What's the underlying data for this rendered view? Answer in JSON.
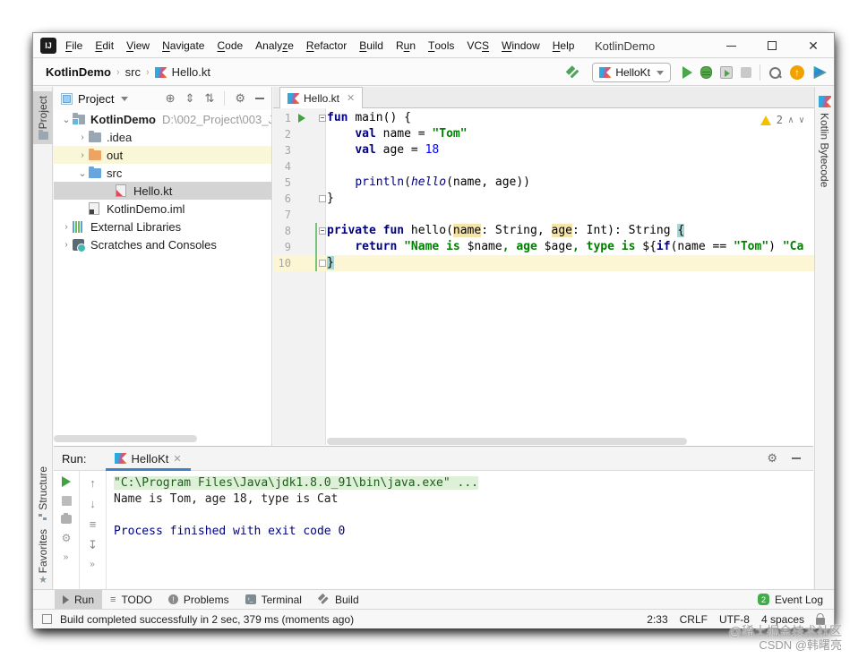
{
  "window": {
    "title": "KotlinDemo"
  },
  "menu": {
    "items": [
      {
        "label": "File",
        "m": 0
      },
      {
        "label": "Edit",
        "m": 0
      },
      {
        "label": "View",
        "m": 0
      },
      {
        "label": "Navigate",
        "m": 0
      },
      {
        "label": "Code",
        "m": 0
      },
      {
        "label": "Analyze",
        "m": 5
      },
      {
        "label": "Refactor",
        "m": 0
      },
      {
        "label": "Build",
        "m": 0
      },
      {
        "label": "Run",
        "m": 1
      },
      {
        "label": "Tools",
        "m": 0
      },
      {
        "label": "VCS",
        "m": 2
      },
      {
        "label": "Window",
        "m": 0
      },
      {
        "label": "Help",
        "m": 0
      }
    ]
  },
  "toolbar": {
    "breadcrumb": [
      "KotlinDemo",
      "src",
      "Hello.kt"
    ],
    "run_config": "HelloKt"
  },
  "left_strip": {
    "top": [
      {
        "label": "Project",
        "active": true
      }
    ],
    "bottom": [
      {
        "label": "Structure"
      },
      {
        "label": "Favorites"
      }
    ]
  },
  "right_strip": {
    "label": "Kotlin Bytecode"
  },
  "project": {
    "header": "Project",
    "tree": [
      {
        "label": "KotlinDemo",
        "suffix": "D:\\002_Project\\003_J",
        "icon": "folder-root",
        "pad": 7,
        "chevron": "v",
        "bold": true
      },
      {
        "label": ".idea",
        "icon": "folder-gray",
        "pad": 25,
        "chevron": ">"
      },
      {
        "label": "out",
        "icon": "folder-orange",
        "pad": 25,
        "chevron": ">",
        "row": "hl-yellow"
      },
      {
        "label": "src",
        "icon": "folder-blue",
        "pad": 25,
        "chevron": "v"
      },
      {
        "label": "Hello.kt",
        "icon": "kotlin-file",
        "pad": 55,
        "row": "selected"
      },
      {
        "label": "KotlinDemo.iml",
        "icon": "iml-file",
        "pad": 25
      },
      {
        "label": "External Libraries",
        "icon": "libraries",
        "pad": 7,
        "chevron": ">"
      },
      {
        "label": "Scratches and Consoles",
        "icon": "scratches",
        "pad": 7,
        "chevron": ">"
      }
    ]
  },
  "editor": {
    "tab": "Hello.kt",
    "warning_count": "2",
    "lines": [
      {
        "n": "1",
        "run": true,
        "fold": "start",
        "tokens": [
          [
            "k",
            "fun"
          ],
          [
            "p",
            " "
          ],
          [
            "p",
            "main"
          ],
          [
            "p",
            "() {"
          ]
        ]
      },
      {
        "n": "2",
        "tokens": [
          [
            "p",
            "    "
          ],
          [
            "k",
            "val"
          ],
          [
            "p",
            " name = "
          ],
          [
            "s",
            "\"Tom\""
          ]
        ]
      },
      {
        "n": "3",
        "tokens": [
          [
            "p",
            "    "
          ],
          [
            "k",
            "val"
          ],
          [
            "p",
            " age = "
          ],
          [
            "n",
            "18"
          ]
        ]
      },
      {
        "n": "4",
        "tokens": []
      },
      {
        "n": "5",
        "tokens": [
          [
            "p",
            "    "
          ],
          [
            "fn",
            "println"
          ],
          [
            "p",
            "("
          ],
          [
            "it",
            "hello"
          ],
          [
            "p",
            "(name, age))"
          ]
        ]
      },
      {
        "n": "6",
        "fold": "end",
        "tokens": [
          [
            "p",
            "}"
          ]
        ]
      },
      {
        "n": "7",
        "tokens": []
      },
      {
        "n": "8",
        "fold": "start",
        "tokens": [
          [
            "k",
            "private"
          ],
          [
            "p",
            " "
          ],
          [
            "k",
            "fun"
          ],
          [
            "p",
            " hello("
          ],
          [
            "hl",
            "name"
          ],
          [
            "p",
            ": String, "
          ],
          [
            "hl",
            "age"
          ],
          [
            "p",
            ": Int): String "
          ],
          [
            "bh",
            "{"
          ]
        ]
      },
      {
        "n": "9",
        "tokens": [
          [
            "p",
            "    "
          ],
          [
            "k",
            "return"
          ],
          [
            "p",
            " "
          ],
          [
            "s",
            "\"Name is "
          ],
          [
            "v",
            "$name"
          ],
          [
            "s",
            ", age "
          ],
          [
            "v",
            "$age"
          ],
          [
            "s",
            ", type is "
          ],
          [
            "v",
            "${"
          ],
          [
            "k",
            "if"
          ],
          [
            "p",
            "(name == "
          ],
          [
            "s",
            "\"Tom\""
          ],
          [
            "p",
            ") "
          ],
          [
            "s",
            "\"Ca"
          ]
        ]
      },
      {
        "n": "10",
        "fold": "end",
        "cur": true,
        "tokens": [
          [
            "bh",
            "}"
          ]
        ]
      }
    ]
  },
  "run_panel": {
    "label": "Run:",
    "tab": "HelloKt",
    "console": [
      {
        "cls": "cl-cmd",
        "text": "\"C:\\Program Files\\Java\\jdk1.8.0_91\\bin\\java.exe\" ..."
      },
      {
        "cls": "",
        "text": "Name is Tom, age 18, type is Cat"
      },
      {
        "cls": "",
        "text": ""
      },
      {
        "cls": "cl-info",
        "text": "Process finished with exit code 0"
      }
    ]
  },
  "bottom_bar": {
    "items": [
      {
        "label": "Run",
        "icon": "run",
        "active": true
      },
      {
        "label": "TODO",
        "icon": "todo"
      },
      {
        "label": "Problems",
        "icon": "problems"
      },
      {
        "label": "Terminal",
        "icon": "terminal"
      },
      {
        "label": "Build",
        "icon": "build"
      }
    ],
    "event_log": {
      "label": "Event Log",
      "count": "2"
    }
  },
  "status_bar": {
    "message": "Build completed successfully in 2 sec, 379 ms (moments ago)",
    "right": [
      "2:33",
      "CRLF",
      "UTF-8",
      "4 spaces"
    ]
  },
  "watermark": {
    "line1": "@稀土掘金技术社区",
    "line2": "CSDN @韩曙亮"
  }
}
